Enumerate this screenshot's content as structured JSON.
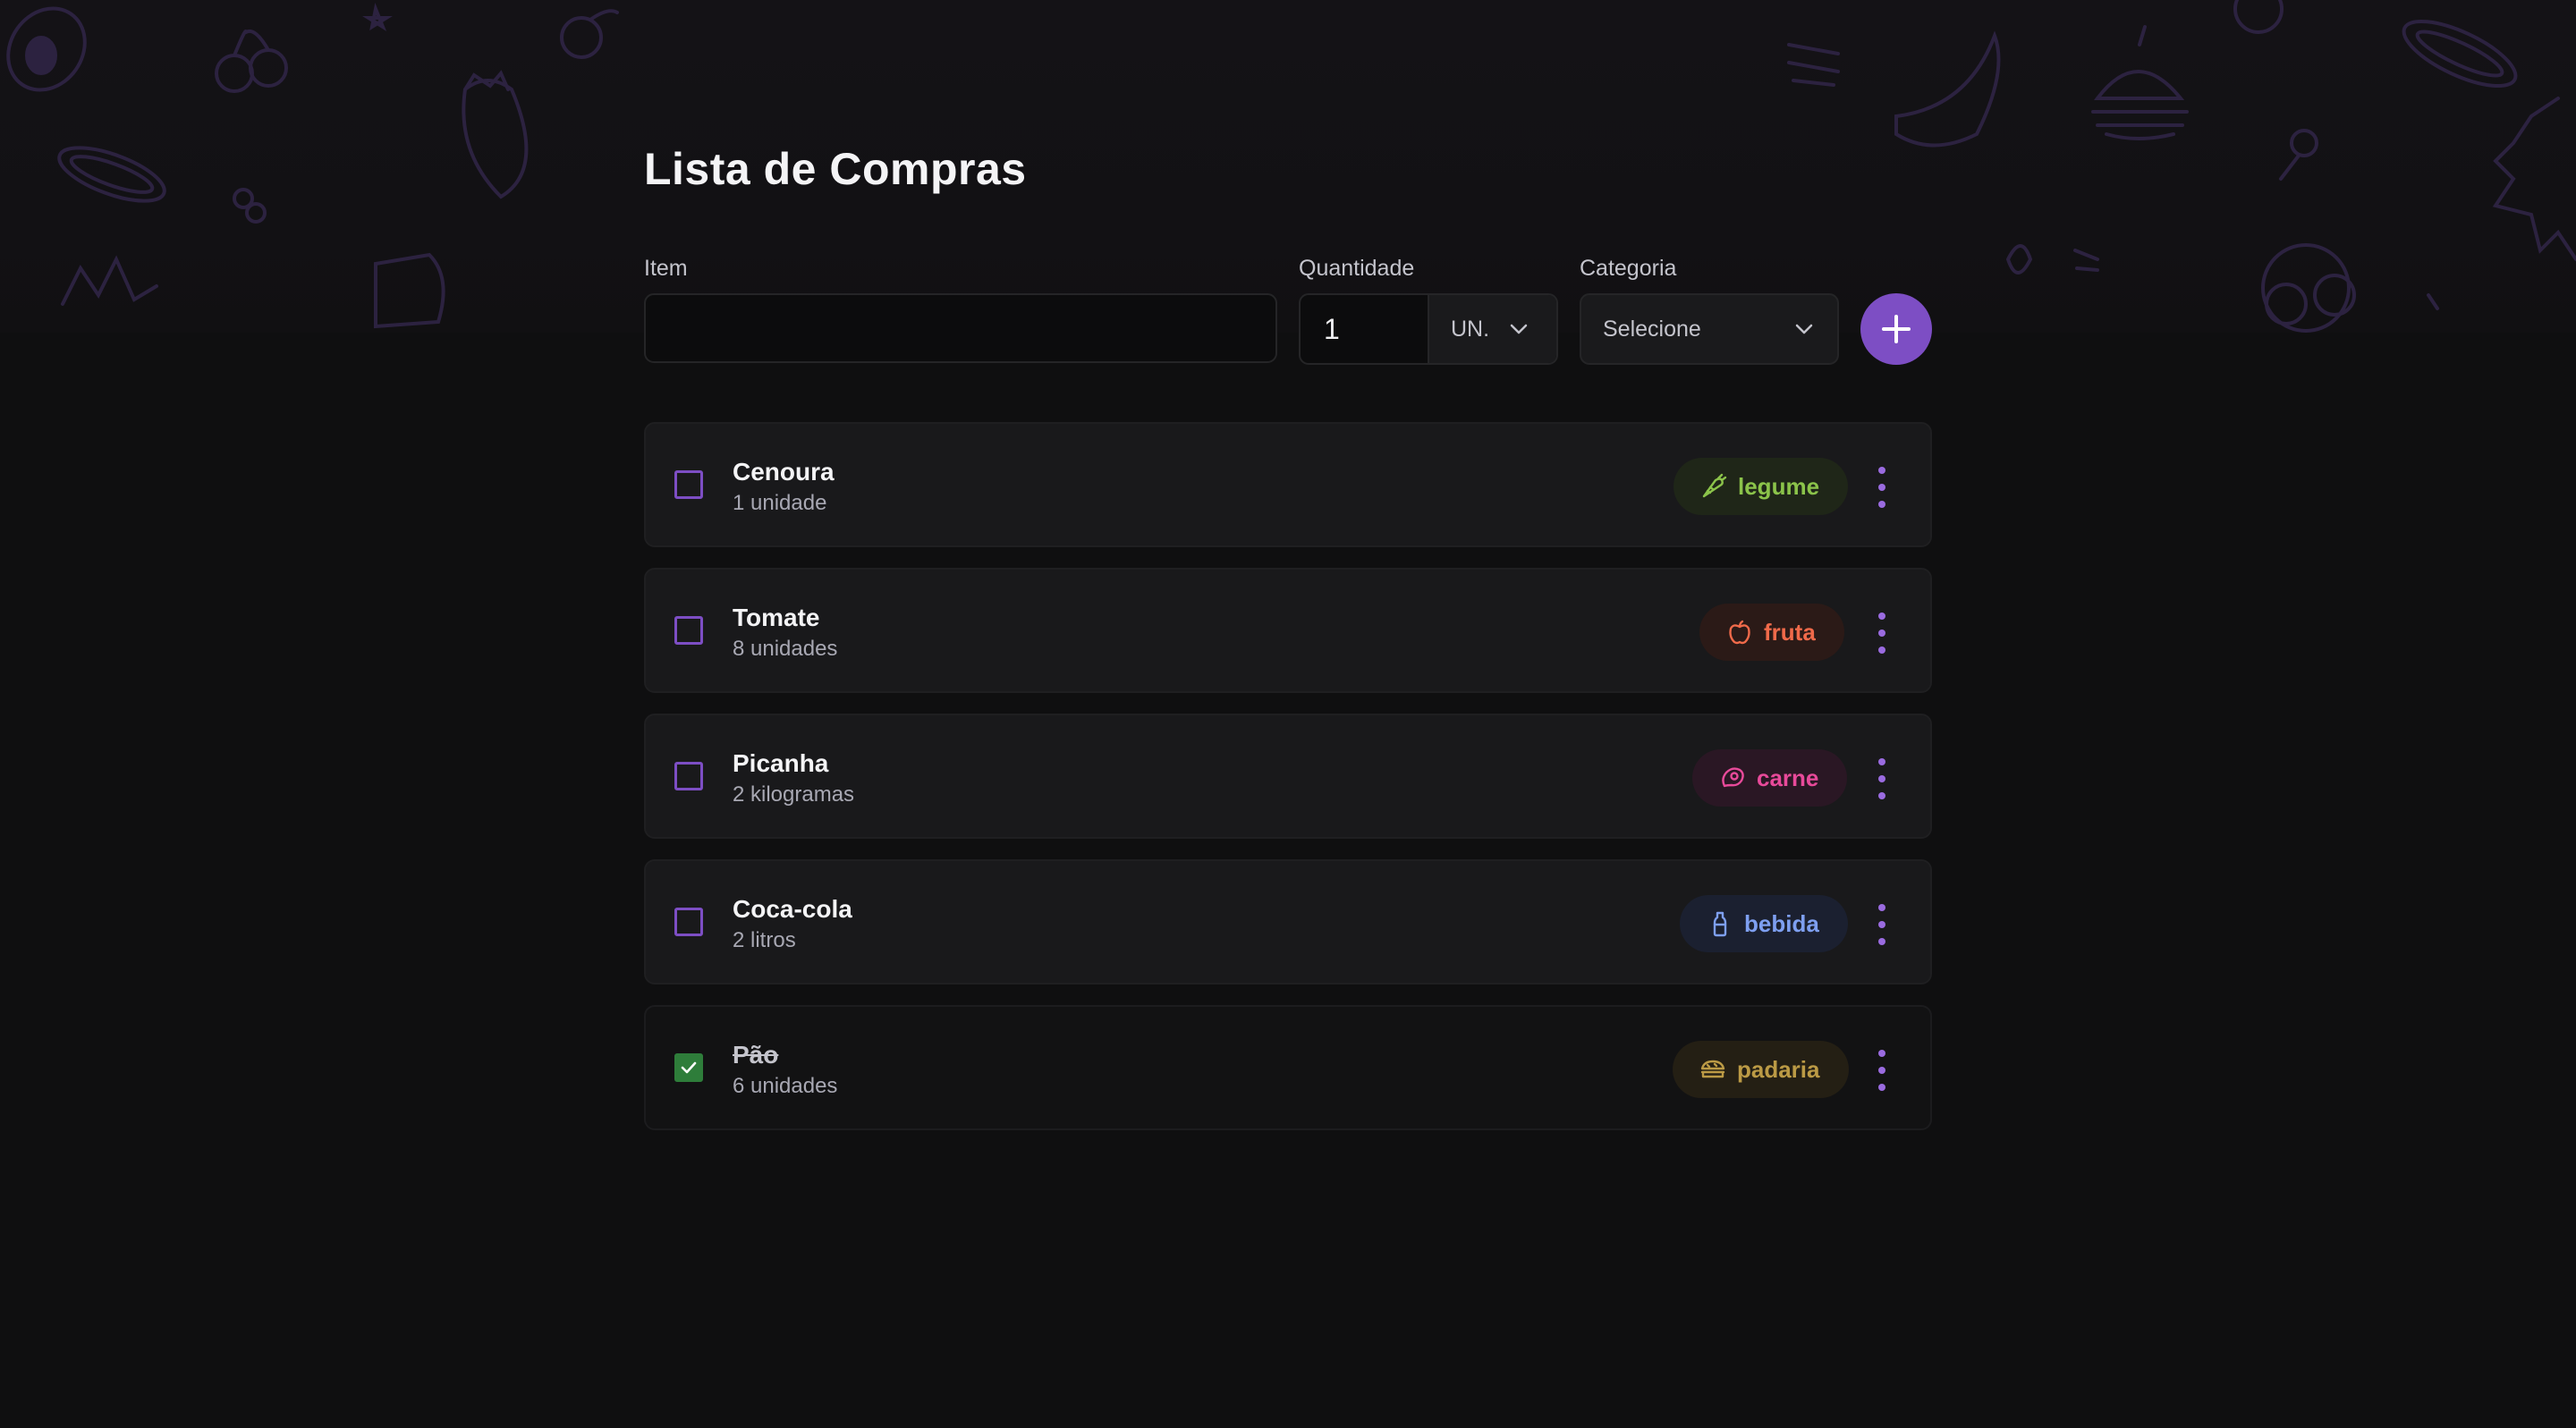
{
  "page": {
    "title": "Lista de Compras"
  },
  "form": {
    "item_label": "Item",
    "item_value": "",
    "quantity_label": "Quantidade",
    "quantity_value": "1",
    "unit_value": "UN.",
    "category_label": "Categoria",
    "category_value": "Selecione",
    "add_icon": "plus-icon"
  },
  "items": [
    {
      "name": "Cenoura",
      "quantity": "1 unidade",
      "category": "legume",
      "icon": "carrot-icon",
      "color": "#8bc34a",
      "bg": "#1f2618",
      "checked": false
    },
    {
      "name": "Tomate",
      "quantity": "8 unidades",
      "category": "fruta",
      "icon": "apple-icon",
      "color": "#f06a4a",
      "bg": "#2b1a17",
      "checked": false
    },
    {
      "name": "Picanha",
      "quantity": "2 kilogramas",
      "category": "carne",
      "icon": "steak-icon",
      "color": "#e84a9a",
      "bg": "#2a1724",
      "checked": false
    },
    {
      "name": "Coca-cola",
      "quantity": "2 litros",
      "category": "bebida",
      "icon": "bottle-icon",
      "color": "#7e9ff0",
      "bg": "#1b2030",
      "checked": false
    },
    {
      "name": "Pão",
      "quantity": "6 unidades",
      "category": "padaria",
      "icon": "sandwich-icon",
      "color": "#bb9a45",
      "bg": "#241f14",
      "checked": true
    }
  ],
  "colors": {
    "accent": "#7d4ec4",
    "checked": "#2e7d3a",
    "background": "#0f0f10",
    "card": "#19191b"
  }
}
